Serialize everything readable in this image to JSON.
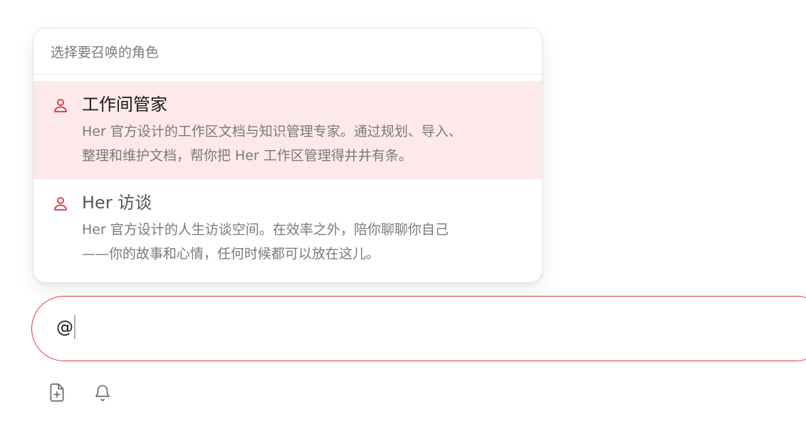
{
  "popup": {
    "header": "选择要召唤的角色",
    "options": [
      {
        "title": "工作间管家",
        "desc_lines": [
          "Her 官方设计的工作区文档与知识管理专家。通过规划、导入、",
          "整理和维护文档，帮你把 Her 工作区管理得井井有条。"
        ],
        "icon": "user-icon",
        "selected": true
      },
      {
        "title": "Her 访谈",
        "desc_lines": [
          "Her 官方设计的人生访谈空间。在效率之外，陪你聊聊你自己",
          "——你的故事和心情，任何时候都可以放在这儿。"
        ],
        "icon": "user-icon",
        "selected": false
      }
    ]
  },
  "input": {
    "value": "@"
  },
  "toolbar": {
    "buttons": [
      "add-file-icon",
      "bell-icon"
    ]
  },
  "colors": {
    "accent": "#d9363e",
    "selected_bg": "#fde9e9"
  }
}
